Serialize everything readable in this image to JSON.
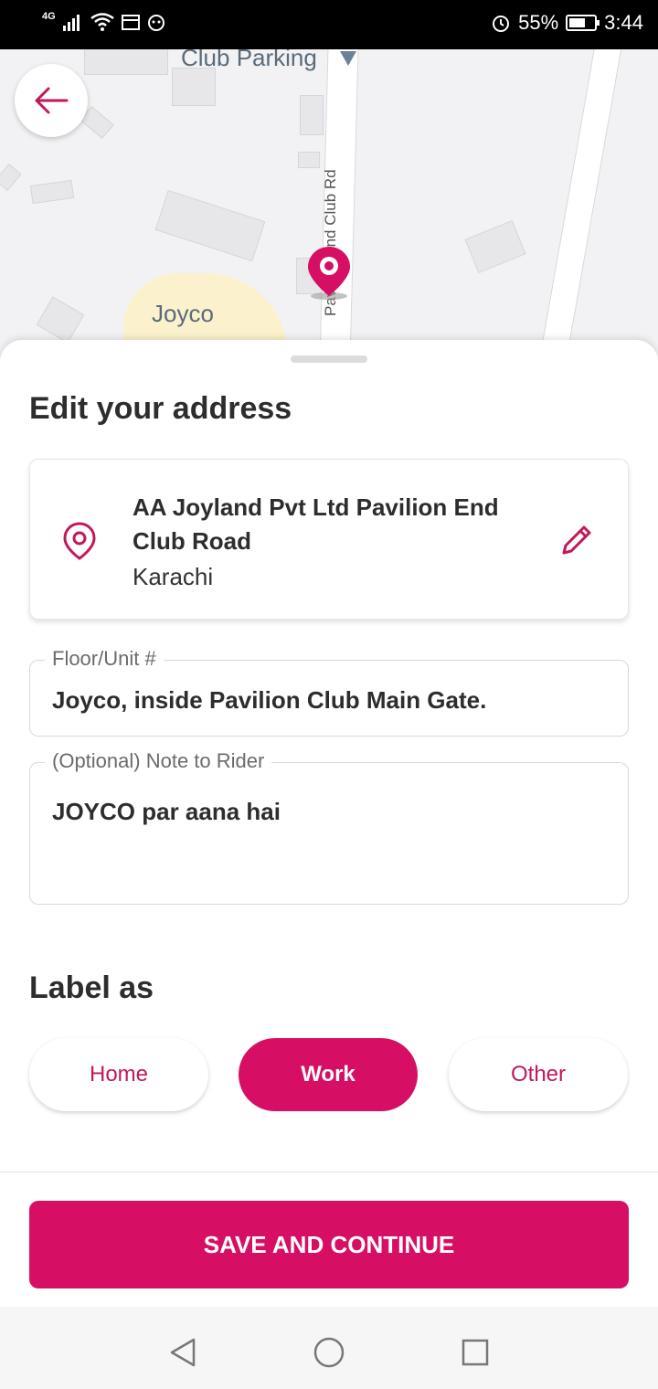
{
  "status_bar": {
    "network": "4G",
    "battery": "55%",
    "time": "3:44"
  },
  "map": {
    "labels": {
      "club_parking": "Club Parking",
      "joyco": "Joyco",
      "road": "Pavilion End Club Rd"
    }
  },
  "sheet": {
    "title": "Edit your address",
    "address": {
      "line1": "AA Joyland Pvt Ltd Pavilion End Club Road",
      "city": "Karachi"
    },
    "floor_field": {
      "label": "Floor/Unit #",
      "value": "Joyco, inside Pavilion Club Main Gate."
    },
    "note_field": {
      "label": "(Optional) Note to Rider",
      "value": "JOYCO par aana hai"
    },
    "label_as": {
      "title": "Label as",
      "options": [
        "Home",
        "Work",
        "Other"
      ],
      "selected": "Work"
    }
  },
  "footer": {
    "save_label": "SAVE AND CONTINUE"
  },
  "colors": {
    "accent": "#d70f64",
    "accent_text": "#c2185b"
  }
}
